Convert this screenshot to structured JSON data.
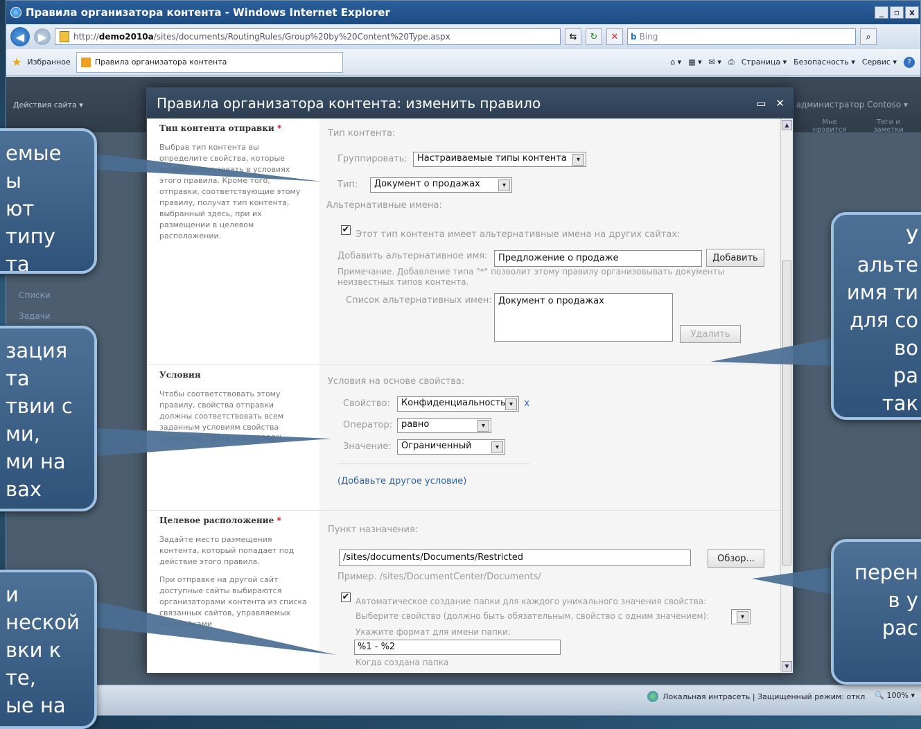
{
  "browser": {
    "title": "Правила организатора контента - Windows Internet Explorer",
    "url_prefix": "http://",
    "url_host": "demo2010a",
    "url_path": "/sites/documents/RoutingRules/Group%20by%20Content%20Type.aspx",
    "search_placeholder": "Bing",
    "favorites_label": "Избранное",
    "tab_label": "Правила организатора контента",
    "cmd_page": "Страница ▾",
    "cmd_security": "Безопасность ▾",
    "cmd_tools": "Сервис ▾"
  },
  "sharepoint": {
    "site_actions": "Действия сайта ▾",
    "user": "администратор Contoso ▾",
    "left_nav": [
      "Списки",
      "Задачи"
    ],
    "ribbon_icons": [
      "Мне нравится",
      "Теги и заметки"
    ]
  },
  "dialog": {
    "title": "Правила организатора контента: изменить правило",
    "section1": {
      "heading": "Тип контента отправки",
      "description": "Выбрав тип контента вы определите свойства, которые можно использовать в условиях этого правила. Кроме того, отправки, соответствующие этому правилу, получат тип контента, выбранный здесь, при их размещении в целевом расположении.",
      "content_type_label": "Тип контента:",
      "group_label": "Группировать:",
      "group_value": "Настраиваемые типы контента",
      "type_label": "Тип:",
      "type_value": "Документ о продажах",
      "alt_names_label": "Альтернативные имена:",
      "alt_checkbox_label": "Этот тип контента имеет альтернативные имена на других сайтах:",
      "add_alt_label": "Добавить альтернативное имя:",
      "add_alt_value": "Предложение о продаже",
      "add_button": "Добавить",
      "note": "Примечание. Добавление типа \"*\" позволит этому правилу организовывать документы неизвестных типов контента.",
      "alt_list_label": "Список альтернативных имен:",
      "alt_list_value": "Документ о продажах",
      "remove_button": "Удалить"
    },
    "section2": {
      "heading": "Условия",
      "description": "Чтобы соответствовать этому правилу, свойства отправки должны соответствовать всем заданным условиям свойства (например, \"Дата > 1/1/2000\")",
      "conditions_label": "Условия на основе свойства:",
      "property_label": "Свойство:",
      "property_value": "Конфиденциальность",
      "operator_label": "Оператор:",
      "operator_value": "равно",
      "value_label": "Значение:",
      "value_value": "Ограниченный",
      "add_condition": "(Добавьте другое условие)"
    },
    "section3": {
      "heading": "Целевое расположение",
      "description1": "Задайте место размещения контента, который попадает под действие этого правила.",
      "description2": "При отправке на другой сайт доступные сайты выбираются организаторами контента из списка связанных сайтов, управляемых настройками",
      "destination_label": "Пункт назначения:",
      "destination_value": "/sites/documents/Documents/Restricted",
      "browse_button": "Обзор...",
      "example": "Пример. /sites/DocumentCenter/Documents/",
      "auto_folder_label": "Автоматическое создание папки для каждого уникального значения свойства:",
      "choose_property": "Выберите свойство (должно быть обязательным, свойство с одним значением):",
      "folder_format_label": "Укажите формат для имени папки:",
      "folder_format_value": "%1 - %2",
      "folder_created": "Когда создана папка"
    }
  },
  "statusbar": {
    "zone": "Локальная интрасеть | Защищенный режим: откл",
    "zoom": "100%"
  },
  "callouts": {
    "left1": "емые\nы\nют типу\nта",
    "left2": "зация\nта\nтвии с\nми,\nми на\nвах",
    "left3": "и\nнеской\nвки к\nте,\nые на",
    "right1": "У\nальте\nимя ти\nдля со\nво\nра\nтак",
    "right2": "перен\nв у\nрас"
  }
}
